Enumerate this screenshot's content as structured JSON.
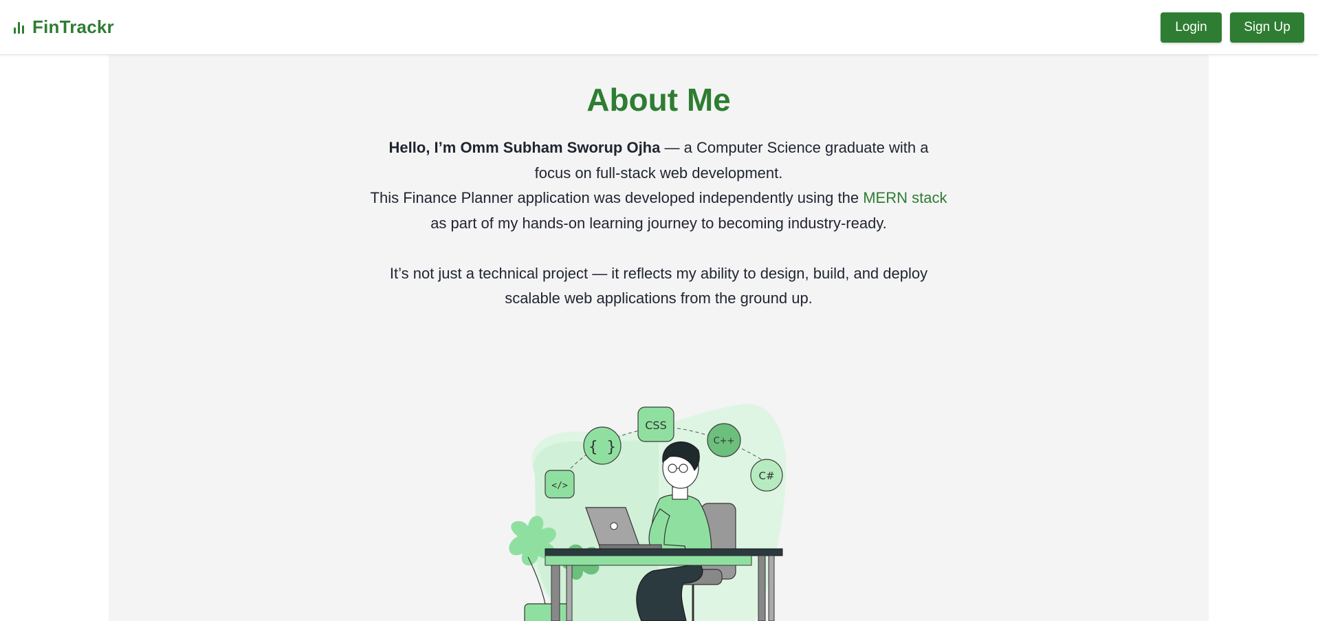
{
  "brand": {
    "name": "FinTrackr",
    "icon": "bar-chart-icon",
    "color": "#2e7d32"
  },
  "nav": {
    "login_label": "Login",
    "signup_label": "Sign Up"
  },
  "about": {
    "title": "About Me",
    "intro_name": "Hello, I’m Omm Subham Sworup Ojha",
    "intro_rest": " — a Computer Science graduate with a focus on full-stack web development.",
    "line2_pre": "This Finance Planner application was developed independently using the ",
    "line2_highlight": "MERN stack",
    "line2_post": " as part of my hands-on learning journey to becoming industry-ready.",
    "paragraph2": "It’s not just a technical project — it reflects my ability to design, build, and deploy scalable web applications from the ground up."
  },
  "illustration": {
    "badges": [
      "</>",
      "{ }",
      "CSS",
      "C++",
      "C#"
    ]
  },
  "colors": {
    "accent": "#2e7d32",
    "panel_bg": "#f4f4f4",
    "light_green": "#8fe0a0",
    "pale_green": "#dff5e3"
  }
}
